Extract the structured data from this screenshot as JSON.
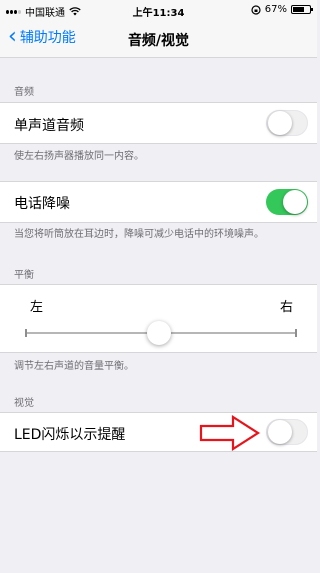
{
  "status_bar": {
    "carrier": "中国联通",
    "time": "上午11:34",
    "battery_text": "67%",
    "battery_level": 0.67
  },
  "nav": {
    "back_label": "辅助功能",
    "title": "音频/视觉"
  },
  "audio_section": {
    "header": "音频",
    "mono_audio_label": "单声道音频",
    "mono_audio_on": false,
    "mono_audio_footer": "使左右扬声器播放同一内容。",
    "noise_cancel_label": "电话降噪",
    "noise_cancel_on": true,
    "noise_cancel_footer": "当您将听筒放在耳边时，降噪可减少电话中的环境噪声。"
  },
  "balance_section": {
    "header": "平衡",
    "left_label": "左",
    "right_label": "右",
    "balance_value": 0.5,
    "footer": "调节左右声道的音量平衡。"
  },
  "visual_section": {
    "header": "视觉",
    "led_flash_label": "LED闪烁以示提醒",
    "led_flash_on": false
  },
  "colors": {
    "accent": "#007aff",
    "switch_on": "#34c759",
    "annotation_arrow": "#e8141b"
  },
  "icons": {
    "back": "chevron-left-icon",
    "wifi": "wifi-icon",
    "lock_rotation": "rotation-lock-icon",
    "battery": "battery-icon",
    "annotation": "red-outline-arrow-icon"
  }
}
